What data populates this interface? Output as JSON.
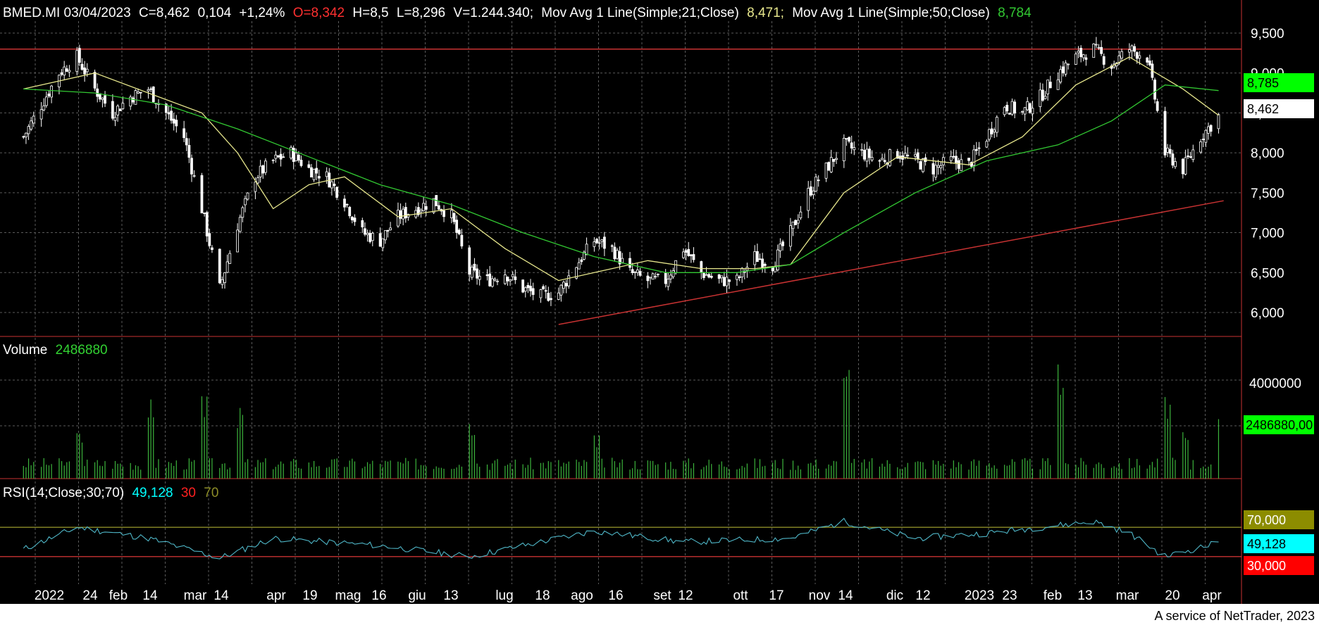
{
  "header": {
    "symbol_date": "BMED.MI 03/04/2023",
    "close": "C=8,462",
    "change": "0,104",
    "change_pct": "+1,24%",
    "open": "O=8,342",
    "high": "H=8,5",
    "low": "L=8,296",
    "volume": "V=1.244.340;",
    "ma1_label": "Mov Avg 1 Line(Simple;21;Close)",
    "ma1_value": "8,471;",
    "ma2_label": "Mov Avg 1 Line(Simple;50;Close)",
    "ma2_value": "8,784"
  },
  "volume_panel": {
    "label": "Volume",
    "value": "2486880",
    "badge": "2486880,00",
    "tick": "4000000"
  },
  "rsi_panel": {
    "label": "RSI(14;Close;30;70)",
    "value": "49,128",
    "low": "30",
    "high": "70",
    "badge_high": "70,000",
    "badge_value": "49,128",
    "badge_low": "30,000"
  },
  "price_badges": {
    "ma50": "8,785",
    "last": "8,462"
  },
  "footer": "A service of NetTrader, 2023",
  "colors": {
    "background": "#000000",
    "grid": "#5a5a5a",
    "candle": "#ffffff",
    "ma21": "#e6e68c",
    "ma50": "#32c832",
    "trendline": "#c83232",
    "volume": "#3cb43c",
    "rsi": "#4fb7c8",
    "rsi_bounds": "#8c8c28",
    "badge_green": "#00ff00",
    "badge_cyan": "#00ffff",
    "badge_red": "#ff0000",
    "badge_olive": "#8c8c00"
  },
  "chart_data": {
    "type": "candlestick",
    "title": "BMED.MI",
    "x_axis": {
      "labels": [
        "2022",
        "24",
        "feb",
        "14",
        "mar",
        "14",
        "apr",
        "19",
        "mag",
        "16",
        "giu",
        "13",
        "lug",
        "18",
        "ago",
        "16",
        "set",
        "12",
        "ott",
        "17",
        "nov",
        "14",
        "dic",
        "12",
        "2023",
        "23",
        "feb",
        "13",
        "mar",
        "20",
        "apr"
      ],
      "range": [
        "2022-01-01",
        "2023-04-05"
      ]
    },
    "y_axis": {
      "ticks": [
        6000,
        6500,
        7000,
        7500,
        8000,
        8500,
        9000,
        9500
      ],
      "tick_labels": [
        "6,000",
        "6,500",
        "7,000",
        "7,500",
        "8,000",
        "8,500",
        "9,000",
        "9,500"
      ],
      "range": [
        5700,
        9650
      ]
    },
    "grid": true,
    "close_series": [
      {
        "d": "2021-12-20",
        "v": 8.2
      },
      {
        "d": "2021-12-27",
        "v": 8.6
      },
      {
        "d": "2022-01-03",
        "v": 9.0
      },
      {
        "d": "2022-01-10",
        "v": 9.2
      },
      {
        "d": "2022-01-17",
        "v": 8.8
      },
      {
        "d": "2022-01-24",
        "v": 8.5
      },
      {
        "d": "2022-01-31",
        "v": 8.7
      },
      {
        "d": "2022-02-07",
        "v": 8.8
      },
      {
        "d": "2022-02-14",
        "v": 8.5
      },
      {
        "d": "2022-02-21",
        "v": 8.2
      },
      {
        "d": "2022-02-28",
        "v": 7.3
      },
      {
        "d": "2022-03-07",
        "v": 6.3
      },
      {
        "d": "2022-03-14",
        "v": 7.1
      },
      {
        "d": "2022-03-21",
        "v": 7.7
      },
      {
        "d": "2022-03-28",
        "v": 7.9
      },
      {
        "d": "2022-04-04",
        "v": 8.0
      },
      {
        "d": "2022-04-11",
        "v": 7.8
      },
      {
        "d": "2022-04-18",
        "v": 7.7
      },
      {
        "d": "2022-04-25",
        "v": 7.4
      },
      {
        "d": "2022-05-02",
        "v": 7.0
      },
      {
        "d": "2022-05-09",
        "v": 6.9
      },
      {
        "d": "2022-05-16",
        "v": 7.2
      },
      {
        "d": "2022-05-23",
        "v": 7.3
      },
      {
        "d": "2022-05-30",
        "v": 7.4
      },
      {
        "d": "2022-06-06",
        "v": 7.2
      },
      {
        "d": "2022-06-13",
        "v": 6.5
      },
      {
        "d": "2022-06-20",
        "v": 6.4
      },
      {
        "d": "2022-06-27",
        "v": 6.5
      },
      {
        "d": "2022-07-04",
        "v": 6.3
      },
      {
        "d": "2022-07-11",
        "v": 6.2
      },
      {
        "d": "2022-07-18",
        "v": 6.25
      },
      {
        "d": "2022-07-25",
        "v": 6.6
      },
      {
        "d": "2022-08-01",
        "v": 6.9
      },
      {
        "d": "2022-08-08",
        "v": 6.8
      },
      {
        "d": "2022-08-15",
        "v": 6.5
      },
      {
        "d": "2022-08-22",
        "v": 6.4
      },
      {
        "d": "2022-08-29",
        "v": 6.4
      },
      {
        "d": "2022-09-05",
        "v": 6.8
      },
      {
        "d": "2022-09-12",
        "v": 6.5
      },
      {
        "d": "2022-09-19",
        "v": 6.4
      },
      {
        "d": "2022-09-26",
        "v": 6.4
      },
      {
        "d": "2022-10-03",
        "v": 6.7
      },
      {
        "d": "2022-10-10",
        "v": 6.6
      },
      {
        "d": "2022-10-17",
        "v": 7.0
      },
      {
        "d": "2022-10-24",
        "v": 7.5
      },
      {
        "d": "2022-10-31",
        "v": 7.8
      },
      {
        "d": "2022-11-07",
        "v": 8.1
      },
      {
        "d": "2022-11-14",
        "v": 8.0
      },
      {
        "d": "2022-11-21",
        "v": 7.9
      },
      {
        "d": "2022-11-28",
        "v": 8.0
      },
      {
        "d": "2022-12-05",
        "v": 7.9
      },
      {
        "d": "2022-12-12",
        "v": 7.8
      },
      {
        "d": "2022-12-19",
        "v": 7.9
      },
      {
        "d": "2022-12-26",
        "v": 7.85
      },
      {
        "d": "2023-01-02",
        "v": 8.2
      },
      {
        "d": "2023-01-09",
        "v": 8.6
      },
      {
        "d": "2023-01-16",
        "v": 8.5
      },
      {
        "d": "2023-01-23",
        "v": 8.7
      },
      {
        "d": "2023-01-30",
        "v": 9.0
      },
      {
        "d": "2023-02-06",
        "v": 9.2
      },
      {
        "d": "2023-02-13",
        "v": 9.3
      },
      {
        "d": "2023-02-20",
        "v": 9.1
      },
      {
        "d": "2023-02-27",
        "v": 9.3
      },
      {
        "d": "2023-03-06",
        "v": 9.2
      },
      {
        "d": "2023-03-13",
        "v": 8.0
      },
      {
        "d": "2023-03-20",
        "v": 7.8
      },
      {
        "d": "2023-03-27",
        "v": 8.2
      },
      {
        "d": "2023-04-03",
        "v": 8.46
      }
    ],
    "ma21_series": [
      {
        "d": "2021-12-20",
        "v": 8.8
      },
      {
        "d": "2022-01-17",
        "v": 9.0
      },
      {
        "d": "2022-02-07",
        "v": 8.75
      },
      {
        "d": "2022-02-28",
        "v": 8.5
      },
      {
        "d": "2022-03-14",
        "v": 8.0
      },
      {
        "d": "2022-03-28",
        "v": 7.3
      },
      {
        "d": "2022-04-11",
        "v": 7.6
      },
      {
        "d": "2022-04-25",
        "v": 7.7
      },
      {
        "d": "2022-05-16",
        "v": 7.2
      },
      {
        "d": "2022-06-06",
        "v": 7.3
      },
      {
        "d": "2022-06-27",
        "v": 6.8
      },
      {
        "d": "2022-07-18",
        "v": 6.4
      },
      {
        "d": "2022-08-01",
        "v": 6.5
      },
      {
        "d": "2022-08-22",
        "v": 6.65
      },
      {
        "d": "2022-09-12",
        "v": 6.55
      },
      {
        "d": "2022-10-03",
        "v": 6.55
      },
      {
        "d": "2022-10-17",
        "v": 6.6
      },
      {
        "d": "2022-11-07",
        "v": 7.5
      },
      {
        "d": "2022-11-28",
        "v": 7.95
      },
      {
        "d": "2022-12-26",
        "v": 7.85
      },
      {
        "d": "2023-01-16",
        "v": 8.2
      },
      {
        "d": "2023-02-06",
        "v": 8.85
      },
      {
        "d": "2023-02-27",
        "v": 9.2
      },
      {
        "d": "2023-03-20",
        "v": 8.8
      },
      {
        "d": "2023-04-03",
        "v": 8.47
      }
    ],
    "ma50_series": [
      {
        "d": "2021-12-20",
        "v": 8.8
      },
      {
        "d": "2022-01-17",
        "v": 8.75
      },
      {
        "d": "2022-02-14",
        "v": 8.6
      },
      {
        "d": "2022-03-14",
        "v": 8.3
      },
      {
        "d": "2022-04-11",
        "v": 7.95
      },
      {
        "d": "2022-05-09",
        "v": 7.6
      },
      {
        "d": "2022-06-06",
        "v": 7.35
      },
      {
        "d": "2022-07-04",
        "v": 7.0
      },
      {
        "d": "2022-08-01",
        "v": 6.7
      },
      {
        "d": "2022-08-29",
        "v": 6.5
      },
      {
        "d": "2022-09-26",
        "v": 6.5
      },
      {
        "d": "2022-10-17",
        "v": 6.6
      },
      {
        "d": "2022-11-07",
        "v": 7.0
      },
      {
        "d": "2022-12-05",
        "v": 7.5
      },
      {
        "d": "2023-01-02",
        "v": 7.9
      },
      {
        "d": "2023-01-30",
        "v": 8.1
      },
      {
        "d": "2023-02-20",
        "v": 8.4
      },
      {
        "d": "2023-03-13",
        "v": 8.85
      },
      {
        "d": "2023-04-03",
        "v": 8.78
      }
    ],
    "trendline": [
      {
        "d": "2022-07-18",
        "v": 5.85
      },
      {
        "d": "2023-04-05",
        "v": 7.4
      }
    ],
    "resistance": 9.3,
    "volume_series": [
      {
        "d": "2022-01-10",
        "v": 1.9
      },
      {
        "d": "2022-02-07",
        "v": 3.3
      },
      {
        "d": "2022-02-28",
        "v": 3.4
      },
      {
        "d": "2022-03-14",
        "v": 2.9
      },
      {
        "d": "2022-06-13",
        "v": 2.5
      },
      {
        "d": "2022-08-01",
        "v": 1.8
      },
      {
        "d": "2022-11-07",
        "v": 4.6
      },
      {
        "d": "2023-01-30",
        "v": 4.8
      },
      {
        "d": "2023-03-13",
        "v": 3.4
      },
      {
        "d": "2023-03-20",
        "v": 2.1
      },
      {
        "d": "2023-04-03",
        "v": 2.49
      }
    ],
    "rsi_series": [
      {
        "d": "2021-12-20",
        "v": 40
      },
      {
        "d": "2022-01-10",
        "v": 70
      },
      {
        "d": "2022-02-07",
        "v": 55
      },
      {
        "d": "2022-03-07",
        "v": 28
      },
      {
        "d": "2022-03-28",
        "v": 55
      },
      {
        "d": "2022-05-09",
        "v": 45
      },
      {
        "d": "2022-06-13",
        "v": 30
      },
      {
        "d": "2022-08-01",
        "v": 65
      },
      {
        "d": "2022-09-05",
        "v": 50
      },
      {
        "d": "2022-10-17",
        "v": 55
      },
      {
        "d": "2022-11-07",
        "v": 78
      },
      {
        "d": "2022-12-05",
        "v": 55
      },
      {
        "d": "2023-01-02",
        "v": 62
      },
      {
        "d": "2023-02-13",
        "v": 78
      },
      {
        "d": "2023-02-27",
        "v": 62
      },
      {
        "d": "2023-03-13",
        "v": 30
      },
      {
        "d": "2023-04-03",
        "v": 49
      }
    ],
    "rsi_ticks": [
      "70,000",
      "49,128",
      "30,000"
    ]
  }
}
